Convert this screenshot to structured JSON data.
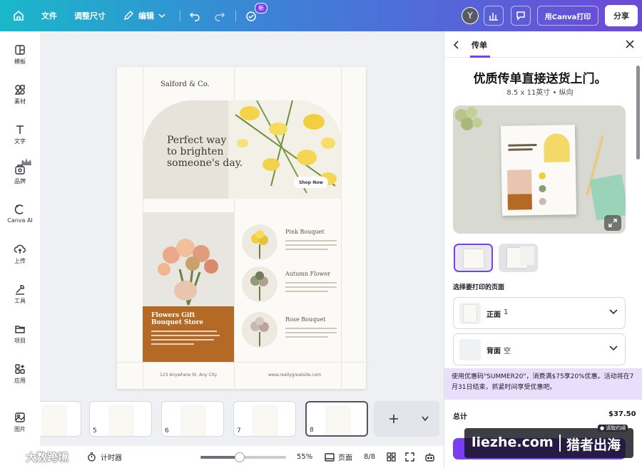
{
  "topbar": {
    "file": "文件",
    "resize": "调整尺寸",
    "edit": "编辑",
    "new_badge": "新",
    "avatar_letter": "Y",
    "print_label": "用Canva打印",
    "share_label": "分享"
  },
  "sidebar": {
    "items": [
      {
        "label": "模板",
        "icon": "template-icon"
      },
      {
        "label": "素材",
        "icon": "elements-icon"
      },
      {
        "label": "文字",
        "icon": "text-icon"
      },
      {
        "label": "品牌",
        "icon": "brand-icon"
      },
      {
        "label": "Canva AI",
        "icon": "canva-ai-icon"
      },
      {
        "label": "上传",
        "icon": "upload-icon"
      },
      {
        "label": "工具",
        "icon": "tools-icon"
      },
      {
        "label": "项目",
        "icon": "folder-icon"
      },
      {
        "label": "应用",
        "icon": "apps-icon"
      },
      {
        "label": "图片",
        "icon": "photos-icon"
      }
    ]
  },
  "design": {
    "brand": "Salford & Co.",
    "hero_title": "Perfect way\nto brighten\nsomeone's day.",
    "shop_button": "Shop Now",
    "store_title": "Flowers Gift\nBouquet Store",
    "products": [
      "Pink Bouquet",
      "Autumn Flower",
      "Rose Bouquet"
    ],
    "address": "123 Anywhere St. Any City",
    "website": "www.reallygreatsite.com"
  },
  "pages": {
    "thumb_numbers": [
      "5",
      "6",
      "7",
      "8"
    ],
    "page_label": "页面",
    "page_count": "8/8"
  },
  "bottombar": {
    "timer": "计时器",
    "zoom": "55%",
    "zoom_fraction": 0.46
  },
  "panel": {
    "tab": "传单",
    "headline": "优质传单直接送货上门。",
    "size": "8.5 x 11英寸 • 纵向",
    "section_label": "选择要打印的页面",
    "front_label": "正面",
    "front_value": "1",
    "back_label": "背面",
    "back_value": "空",
    "promo": "使用优惠码\"SUMMER20\"，消费满$75享20%优惠。活动将在7月31日结束，抓紧时间享受优惠吧。",
    "total_label": "总计",
    "total_value": "$37.50"
  },
  "watermark": {
    "site": "liezhe.com",
    "name": "猎者出海",
    "mini": "● 请取约续",
    "left": "大数跨境"
  },
  "colors": {
    "accent": "#7a3ff0",
    "gold": "#b46a24"
  }
}
